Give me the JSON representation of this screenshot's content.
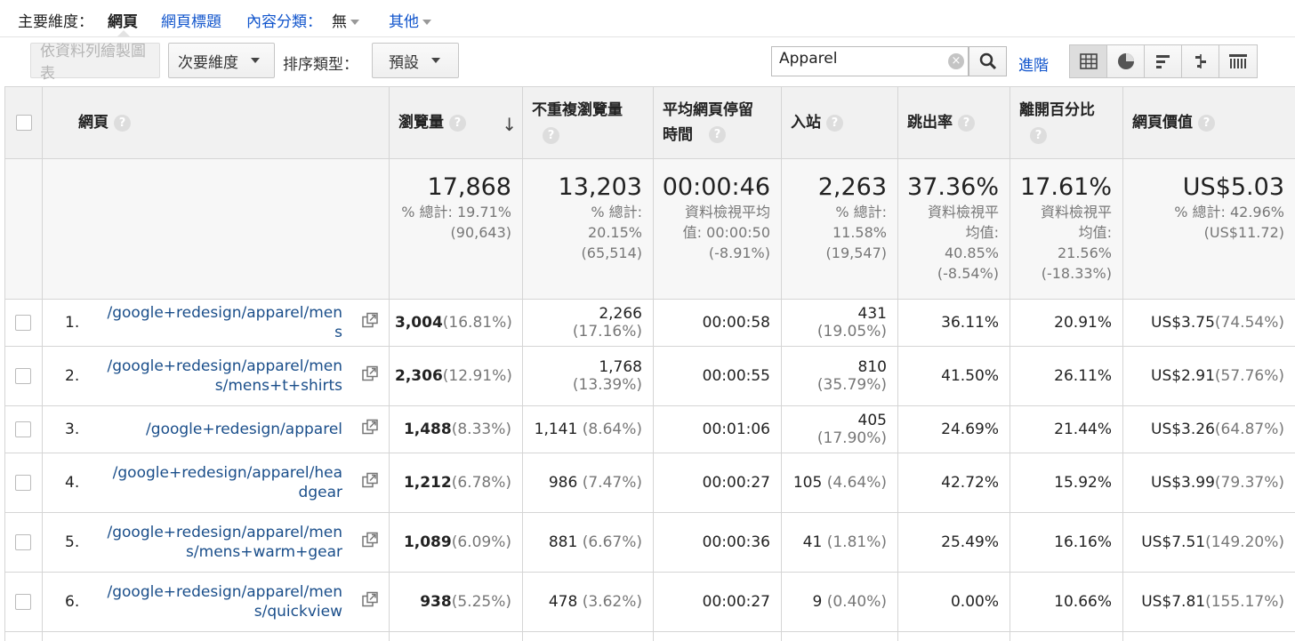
{
  "dimbar": {
    "primary_label": "主要維度：",
    "active": "網頁",
    "page_title": "網頁標題",
    "content_group_label": "內容分類：",
    "content_group_value": "無",
    "other": "其他"
  },
  "toolbar": {
    "plot_rows": "依資料列繪製圖表",
    "secondary_dimension": "次要維度",
    "sort_type_label": "排序類型：",
    "sort_type_value": "預設",
    "search_value": "Apparel",
    "advanced": "進階"
  },
  "headers": {
    "page": "網頁",
    "pageviews": "瀏覽量",
    "unique_pageviews": "不重複瀏覽量",
    "avg_time": "平均網頁停留時間",
    "entrances": "入站",
    "bounce_rate": "跳出率",
    "exit_pct": "離開百分比",
    "page_value": "網頁價值"
  },
  "totals": {
    "pageviews": {
      "value": "17,868",
      "line1": "% 總計: 19.71%",
      "line2": "(90,643)"
    },
    "unique_pageviews": {
      "value": "13,203",
      "line1": "% 總計:",
      "line2": "20.15%",
      "line3": "(65,514)"
    },
    "avg_time": {
      "value": "00:00:46",
      "line1": "資料檢視平均",
      "line2": "值: 00:00:50",
      "line3": "(-8.91%)"
    },
    "entrances": {
      "value": "2,263",
      "line1": "% 總計:",
      "line2": "11.58%",
      "line3": "(19,547)"
    },
    "bounce_rate": {
      "value": "37.36%",
      "line1": "資料檢視平",
      "line2": "均值:",
      "line3": "40.85%",
      "line4": "(-8.54%)"
    },
    "exit_pct": {
      "value": "17.61%",
      "line1": "資料檢視平",
      "line2": "均值:",
      "line3": "21.56%",
      "line4": "(-18.33%)"
    },
    "page_value": {
      "value": "US$5.03",
      "line1": "% 總計: 42.96%",
      "line2": "(US$11.72)"
    }
  },
  "rows": [
    {
      "num": "1.",
      "page": "/google+redesign/apparel/mens",
      "pv": "3,004",
      "pv_pct": "(16.81%)",
      "upv": "2,266",
      "upv_pct": "(17.16%)",
      "time": "00:00:58",
      "ent": "431",
      "ent_pct": "(19.05%)",
      "bounce": "36.11%",
      "exit": "20.91%",
      "value": "US$3.75",
      "value_pct": "(74.54%)"
    },
    {
      "num": "2.",
      "page": "/google+redesign/apparel/mens/mens+t+shirts",
      "pv": "2,306",
      "pv_pct": "(12.91%)",
      "upv": "1,768",
      "upv_pct": "(13.39%)",
      "time": "00:00:55",
      "ent": "810",
      "ent_pct": "(35.79%)",
      "bounce": "41.50%",
      "exit": "26.11%",
      "value": "US$2.91",
      "value_pct": "(57.76%)"
    },
    {
      "num": "3.",
      "page": "/google+redesign/apparel",
      "pv": "1,488",
      "pv_pct": "(8.33%)",
      "upv": "1,141",
      "upv_pct": "(8.64%)",
      "time": "00:01:06",
      "ent": "405",
      "ent_pct": "(17.90%)",
      "bounce": "24.69%",
      "exit": "21.44%",
      "value": "US$3.26",
      "value_pct": "(64.87%)"
    },
    {
      "num": "4.",
      "page": "/google+redesign/apparel/headgear",
      "pv": "1,212",
      "pv_pct": "(6.78%)",
      "upv": "986",
      "upv_pct": "(7.47%)",
      "time": "00:00:27",
      "ent": "105",
      "ent_pct": "(4.64%)",
      "bounce": "42.72%",
      "exit": "15.92%",
      "value": "US$3.99",
      "value_pct": "(79.37%)"
    },
    {
      "num": "5.",
      "page": "/google+redesign/apparel/mens/mens+warm+gear",
      "pv": "1,089",
      "pv_pct": "(6.09%)",
      "upv": "881",
      "upv_pct": "(6.67%)",
      "time": "00:00:36",
      "ent": "41",
      "ent_pct": "(1.81%)",
      "bounce": "25.49%",
      "exit": "16.16%",
      "value": "US$7.51",
      "value_pct": "(149.20%)"
    },
    {
      "num": "6.",
      "page": "/google+redesign/apparel/mens/quickview",
      "pv": "938",
      "pv_pct": "(5.25%)",
      "upv": "478",
      "upv_pct": "(3.62%)",
      "time": "00:00:27",
      "ent": "9",
      "ent_pct": "(0.40%)",
      "bounce": "0.00%",
      "exit": "10.66%",
      "value": "US$7.81",
      "value_pct": "(155.17%)"
    }
  ],
  "help_glyph": "?",
  "sort_glyph": "↓",
  "clear_glyph": "×"
}
